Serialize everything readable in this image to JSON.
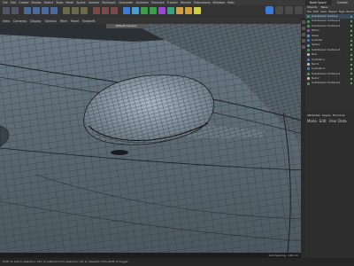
{
  "menu": [
    "File",
    "Edit",
    "Create",
    "Modes",
    "Select",
    "Tools",
    "Mesh",
    "Spline",
    "Volume",
    "MoGraph",
    "Character",
    "Animate",
    "Simulate",
    "Tracker",
    "Render",
    "Extensions",
    "Window",
    "Help"
  ],
  "right_tabs": [
    "Node Space",
    "Current (Standard)"
  ],
  "viewport_menu": [
    "View",
    "Cameras",
    "Display",
    "Options",
    "Filter",
    "Panel",
    "Redshift"
  ],
  "camera_label": "Default Camera",
  "grid_spacing": "Grid Spacing : 100 cm",
  "status_text": "Shift: to add to selection; Ctrl: to subtract from selection; Alt: to deselect; Ctrl+Shift: to toggle",
  "objects": {
    "tabs": [
      "Objects",
      "Takes"
    ],
    "menu": [
      "File",
      "Edit",
      "View",
      "Object",
      "Tags",
      "Bookmarks"
    ],
    "rows": [
      "Subdivision Surface",
      "Subdivision Surface.1",
      "Subdivision Surface.2",
      "Mirror",
      "Glass",
      "Cylinder",
      "Spline",
      "Subdivision Surface.3",
      "Null",
      "Cylinder.1",
      "Null.1",
      "Cylinder.2",
      "Subdivision Surface.4",
      "Null.2",
      "Subdivision Surface.5"
    ]
  },
  "attributes": {
    "tabs": [
      "Attributes",
      "Layers",
      "Structure"
    ],
    "menu": [
      "Mode",
      "Edit",
      "User Data"
    ]
  },
  "colors": {
    "accent": "#3d7bd9",
    "mesh": "#8fa0ad",
    "wire": "#1a1d20"
  }
}
